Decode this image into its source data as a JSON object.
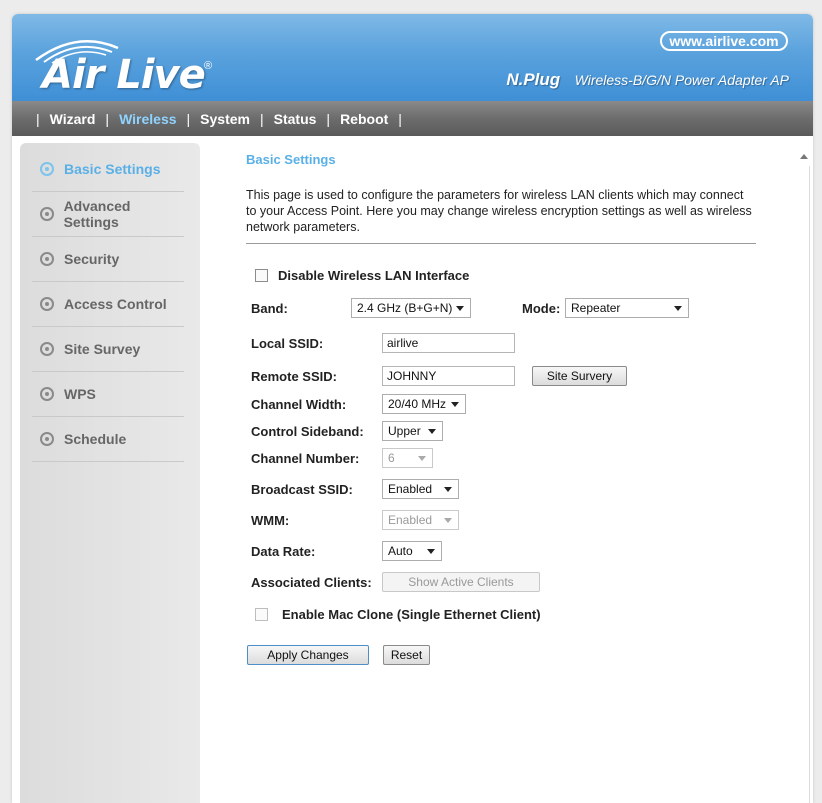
{
  "header": {
    "logo_text": "Air Live",
    "logo_reg": "®",
    "url": "www.airlive.com",
    "product": "N.Plug",
    "product_desc": "Wireless-B/G/N Power Adapter AP"
  },
  "nav": {
    "separator": "|",
    "items": [
      "Wizard",
      "Wireless",
      "System",
      "Status",
      "Reboot"
    ],
    "active": "Wireless"
  },
  "sidebar": {
    "items": [
      "Basic Settings",
      "Advanced Settings",
      "Security",
      "Access Control",
      "Site Survey",
      "WPS",
      "Schedule"
    ],
    "active": "Basic Settings"
  },
  "main": {
    "title": "Basic Settings",
    "description": "This page is used to configure the parameters for wireless LAN clients which may connect to your Access Point. Here you may change wireless encryption settings as well as wireless network parameters.",
    "disable_wlan_label": "Disable Wireless LAN Interface",
    "band_label": "Band:",
    "band_value": "2.4 GHz (B+G+N)",
    "mode_label": "Mode:",
    "mode_value": "Repeater",
    "local_ssid_label": "Local SSID:",
    "local_ssid_value": "airlive",
    "remote_ssid_label": "Remote SSID:",
    "remote_ssid_value": "JOHNNY",
    "site_survey_button": "Site Survery",
    "channel_width_label": "Channel Width:",
    "channel_width_value": "20/40 MHz",
    "control_sideband_label": "Control Sideband:",
    "control_sideband_value": "Upper",
    "channel_number_label": "Channel Number:",
    "channel_number_value": "6",
    "broadcast_ssid_label": "Broadcast SSID:",
    "broadcast_ssid_value": "Enabled",
    "wmm_label": "WMM:",
    "wmm_value": "Enabled",
    "data_rate_label": "Data Rate:",
    "data_rate_value": "Auto",
    "associated_clients_label": "Associated Clients:",
    "show_clients_button": "Show Active Clients",
    "mac_clone_label": "Enable Mac Clone (Single Ethernet Client)",
    "apply_button": "Apply Changes",
    "reset_button": "Reset"
  },
  "colors": {
    "header_blue": "#4a98d9",
    "accent": "#5ab0e6",
    "nav_gray": "#6c6c6c",
    "sidebar_bg": "#e3e3e3"
  }
}
